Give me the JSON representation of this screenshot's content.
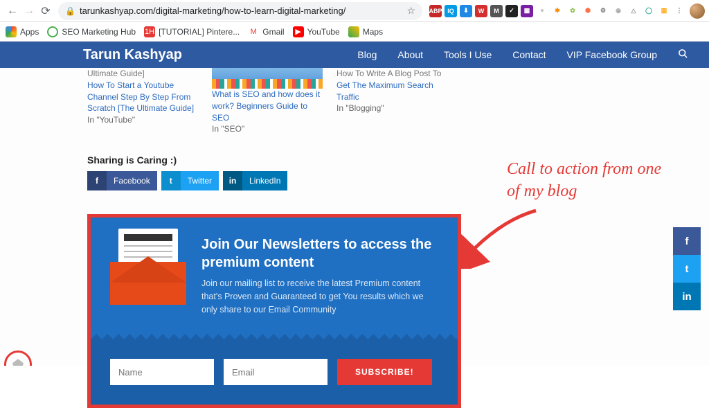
{
  "browser": {
    "url": "tarunkashyap.com/digital-marketing/how-to-learn-digital-marketing/",
    "extensions": [
      "ABP",
      "IQ",
      "⬇",
      "W",
      "M",
      "✓",
      "▦",
      "⚬",
      "✱",
      "✿",
      "⬢",
      "⚙",
      "◉",
      "△",
      "◯",
      "▥",
      "⋮"
    ]
  },
  "bookmarks": {
    "apps": "Apps",
    "seo": "SEO Marketing Hub",
    "pint": "[TUTORIAL] Pintere...",
    "gmail": "Gmail",
    "yt": "YouTube",
    "maps": "Maps"
  },
  "nav": {
    "brand": "Tarun Kashyap",
    "items": [
      "Blog",
      "About",
      "Tools I Use",
      "Contact",
      "VIP Facebook Group"
    ]
  },
  "related": {
    "col1": {
      "cut": "Ultimate Guide]",
      "link": "How To Start a Youtube Channel Step By Step From Scratch [The Ultimate Guide]",
      "meta": "In \"YouTube\""
    },
    "col2": {
      "link": "What is SEO and how does it work? Beginners Guide to SEO",
      "meta": "In \"SEO\""
    },
    "col3": {
      "cut": "How To Write A Blog Post To",
      "link": "Get The Maximum Search Traffic",
      "meta": "In \"Blogging\""
    }
  },
  "sharing": {
    "label": "Sharing is Caring :)",
    "fb": "Facebook",
    "tw": "Twitter",
    "li": "LinkedIn"
  },
  "cta": {
    "heading": "Join Our Newsletters to access the premium content",
    "body": "Join our mailing list to receive the latest Premium content that's Proven and Guaranteed to get You results which we only share to our Email Community",
    "name_ph": "Name",
    "email_ph": "Email",
    "button": "SUBSCRIBE!"
  },
  "annotation": "Call to action from one of my blog"
}
